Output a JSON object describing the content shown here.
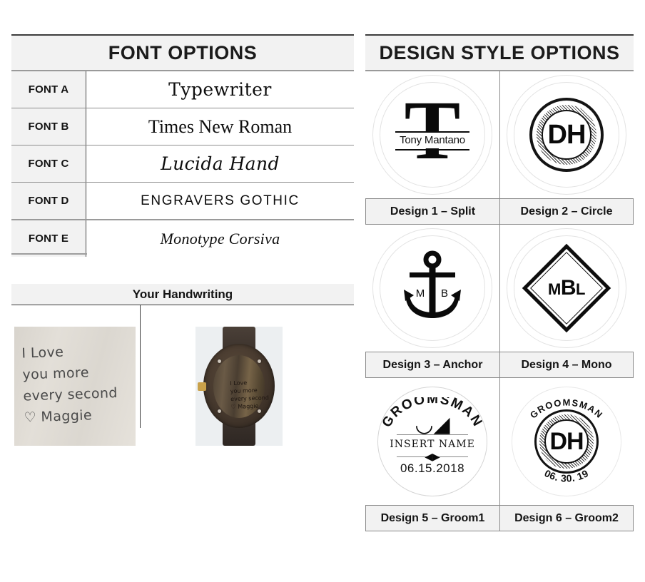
{
  "font_panel": {
    "title": "FONT OPTIONS",
    "rows": [
      {
        "label": "FONT A",
        "sample": "Typewriter"
      },
      {
        "label": "FONT B",
        "sample": "Times New Roman"
      },
      {
        "label": "FONT C",
        "sample": "Lucida Hand"
      },
      {
        "label": "FONT D",
        "sample": "Engravers Gothic"
      },
      {
        "label": "FONT E",
        "sample": "Monotype Corsiva"
      }
    ]
  },
  "handwriting": {
    "title": "Your Handwriting",
    "note_lines": [
      "I Love",
      "you more",
      "every second",
      "♡ Maggie"
    ],
    "watch_lines": [
      "I Love",
      "you more",
      "every second",
      "♡ Maggie"
    ]
  },
  "design_panel": {
    "title": "DESIGN STYLE OPTIONS",
    "designs": [
      {
        "label": "Design 1 – Split",
        "art": {
          "letter": "T",
          "name": "Tony Mantano"
        }
      },
      {
        "label": "Design 2 – Circle",
        "art": {
          "monogram": "DH"
        }
      },
      {
        "label": "Design 3 – Anchor",
        "art": {
          "left_initial": "M",
          "right_initial": "B"
        }
      },
      {
        "label": "Design 4 – Mono",
        "art": {
          "initial_1": "M",
          "initial_2": "B",
          "initial_3": "L"
        }
      },
      {
        "label": "Design 5 – Groom1",
        "art": {
          "arc_text": "GROOMSMAN",
          "name": "INSERT NAME",
          "date": "06.15.2018"
        }
      },
      {
        "label": "Design 6 – Groom2",
        "art": {
          "arc_text": "GROOMSMAN",
          "monogram": "DH",
          "date": "06. 30. 19"
        }
      }
    ]
  },
  "colors": {
    "header_bg": "#f2f2f2",
    "header_rule_dark": "#3c3c3c",
    "line": "#8a8a8a",
    "ink": "#0a0a0a"
  }
}
